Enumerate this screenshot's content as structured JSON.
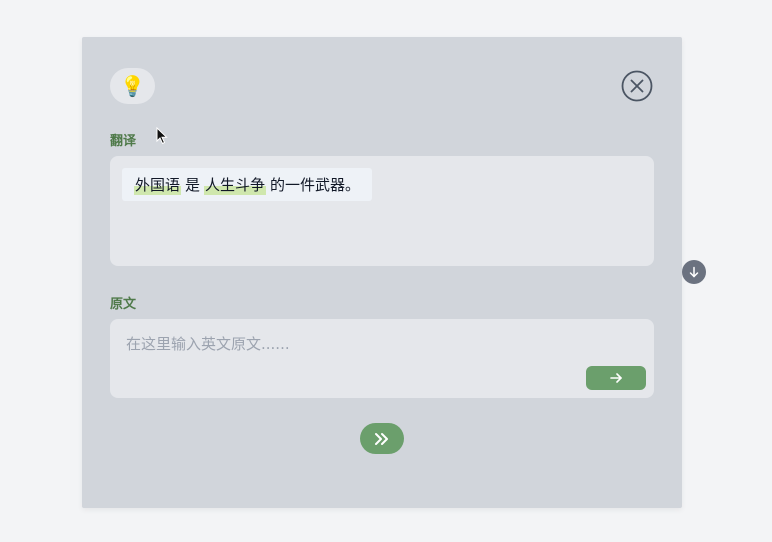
{
  "hint": {
    "icon": "lightbulb-icon",
    "glyph": "💡"
  },
  "close": {
    "icon": "close-circle-icon"
  },
  "translation": {
    "label": "翻译",
    "segments": [
      "外国语",
      "是",
      "人生斗争",
      "的一件武器。"
    ]
  },
  "source": {
    "label": "原文",
    "placeholder": "在这里输入英文原文......",
    "value": ""
  },
  "icons": {
    "submit": "arrow-right-icon",
    "next": "double-chevron-right-icon",
    "scroll": "arrow-down-icon"
  },
  "colors": {
    "accent": "#6b9f6c",
    "label": "#4f7a4a",
    "panel": "#d1d5db",
    "highlight": "#cfe7ad"
  }
}
